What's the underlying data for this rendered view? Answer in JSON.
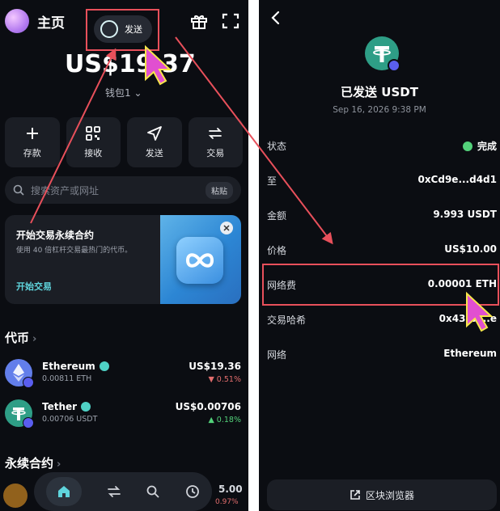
{
  "left": {
    "header": {
      "title": "主页",
      "send_pill_label": "发送"
    },
    "balance": "US$19.37",
    "wallet_label": "钱包1 ⌄",
    "actions": [
      {
        "label": "存款",
        "icon": "plus-icon"
      },
      {
        "label": "接收",
        "icon": "qr-icon"
      },
      {
        "label": "发送",
        "icon": "send-icon"
      },
      {
        "label": "交易",
        "icon": "swap-icon"
      }
    ],
    "search": {
      "placeholder": "搜索资产或网址",
      "paste_label": "粘贴"
    },
    "promo": {
      "title": "开始交易永续合约",
      "subtitle": "使用 40 倍杠杆交易最热门的代币。",
      "cta": "开始交易"
    },
    "tokens_section": "代币",
    "tokens": [
      {
        "name": "Ethereum",
        "amount": "0.00811 ETH",
        "value": "US$19.36",
        "change": "▼ 0.51%",
        "direction": "down"
      },
      {
        "name": "Tether",
        "amount": "0.00706 USDT",
        "value": "US$0.00706",
        "change": "▲ 0.18%",
        "direction": "up"
      }
    ],
    "perps_section": "永续合约",
    "bottom_peek_value": "5.00",
    "bottom_peek_change": "0.97%"
  },
  "right": {
    "title": "已发送 USDT",
    "date": "Sep 16, 2026 9:38 PM",
    "rows": [
      {
        "key": "状态",
        "value": "完成"
      },
      {
        "key": "至",
        "value": "0xCd9e...d4d1"
      },
      {
        "key": "金额",
        "value": "9.993 USDT"
      },
      {
        "key": "价格",
        "value": "US$10.00"
      },
      {
        "key": "网络费",
        "value": "0.00001 ETH"
      },
      {
        "key": "交易哈希",
        "value": "0x43eb...e"
      },
      {
        "key": "网络",
        "value": "Ethereum"
      }
    ],
    "explorer_label": "区块浏览器"
  },
  "colors": {
    "bg": "#0b0d12",
    "card": "#1b1e25",
    "accent_teal": "#5fd4dc",
    "success": "#53d17a",
    "negative": "#e26d6d",
    "highlight": "#e8505b",
    "cursor": "#e14fd0"
  }
}
